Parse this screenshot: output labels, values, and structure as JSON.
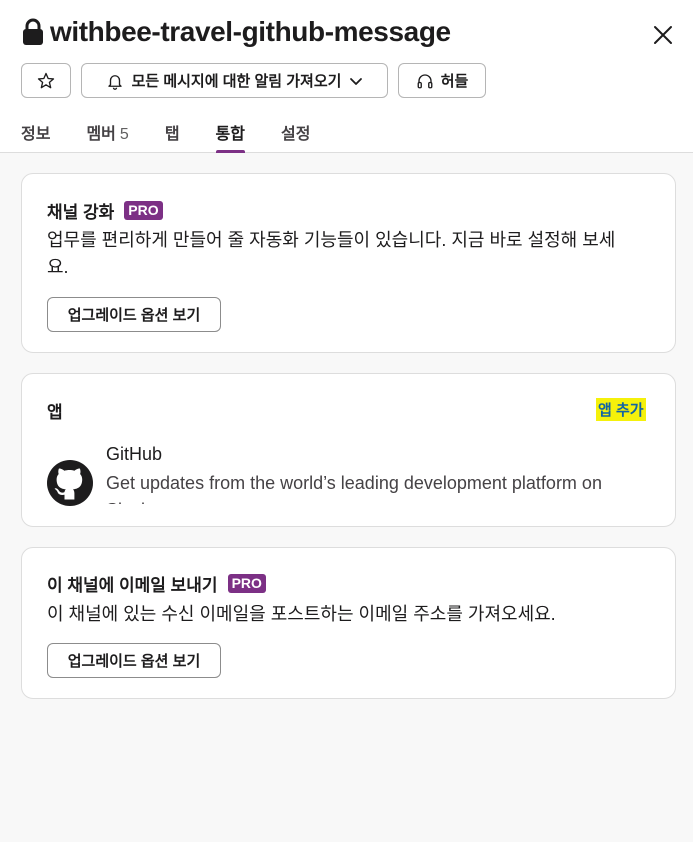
{
  "header": {
    "title": "withbee-travel-github-message",
    "notify_label": "모든 메시지에 대한 알림 가져오기",
    "huddle_label": "허들"
  },
  "tabs": [
    {
      "label": "정보"
    },
    {
      "label": "멤버",
      "count": "5"
    },
    {
      "label": "탭"
    },
    {
      "label": "통합",
      "active": true
    },
    {
      "label": "설정"
    }
  ],
  "enhance": {
    "title": "채널 강화",
    "badge": "PRO",
    "desc_line1": "업무를 편리하게 만들어 줄 자동화 기능들이 있습니다. 지금 바로 설정해 보세",
    "desc_line2": "요.",
    "button": "업그레이드 옵션 보기"
  },
  "apps": {
    "title": "앱",
    "add_label": "앱 추가",
    "items": [
      {
        "name": "GitHub",
        "desc": "Get updates from the world’s leading development platform on Slack",
        "icon": "github-icon"
      }
    ]
  },
  "email": {
    "title": "이 채널에 이메일 보내기",
    "badge": "PRO",
    "desc": "이 채널에 있는 수신 이메일을 포스트하는 이메일 주소를 가져오세요.",
    "button": "업그레이드 옵션 보기"
  },
  "colors": {
    "accent": "#7c3085",
    "link": "#1264a3",
    "highlight": "#f5f10b"
  }
}
